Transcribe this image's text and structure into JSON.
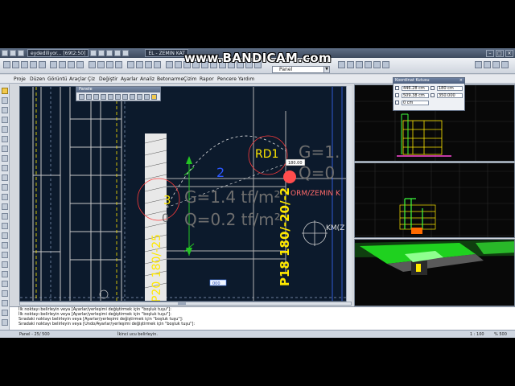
{
  "titlebar": {
    "doc_tab": "eydediliyor... [69t2:50]",
    "file_tab": "EL - ZEMIN KAT"
  },
  "panel_combo": "Panel",
  "menu": [
    "Proje",
    "Düzen",
    "Görüntü",
    "Araçlar",
    "Çiz",
    "Değiştir",
    "Ayarlar",
    "Analiz",
    "Betonarme",
    "Çizim",
    "Rapor",
    "Pencere",
    "Yardım"
  ],
  "floating_toolbar": {
    "title": "Panele"
  },
  "cad": {
    "label_rd1": "RD1",
    "label_g_top": "G=1.",
    "label_q_top": "Q=0",
    "label_dim": "180.00",
    "label_two": "2",
    "label_form": "ORM/ZEMIN K",
    "label_g_mid": "G=1.4 tf/m²",
    "label_q_mid": "Q=0.2 tf/m²",
    "label_p18": "P18 180/-20/-2",
    "label_three": "3",
    "label_zero": "0",
    "label_p20": "P20 180/-25",
    "label_km": "KM(Z",
    "input_val": "000"
  },
  "coord_panel": {
    "title": "Koordinat Kutusu",
    "x_value": "446.28 cm",
    "x2_value": "180 cm",
    "y_value": "509.38 cm",
    "y2_value": "350.000",
    "z_value": "0 cm"
  },
  "command_lines": [
    "İlk noktayı belirleyin veya [Ayarlar/yerleşimi değiştirmek için \"boşluk tuşu\"]:",
    "İlk noktayı belirleyin veya [Ayarlar/yerleşimi değiştirmek için \"boşluk tuşu\"]:",
    "Sıradaki noktayı belirleyin veya [Ayarlar/yerleşimi değiştirmek için \"boşluk tuşu\"]:",
    "Sıradaki noktayı belirleyin veya [Undo/Ayarlar/yerleşimi değiştirmek için \"boşluk tuşu\"]:"
  ],
  "status": {
    "left": "Panel - 25/ 500",
    "mid": "İkinci ucu belirleyin.",
    "scale": "1 : 100",
    "zoom": "% 500"
  },
  "watermark": "www.BANDICAM.com",
  "colors": {
    "cad_bg": "#0c1a2c",
    "accent_yellow": "#ffe800",
    "grid_gray": "#a9a9a9",
    "beam_green": "#24c424",
    "view_green": "#3dff3d"
  }
}
